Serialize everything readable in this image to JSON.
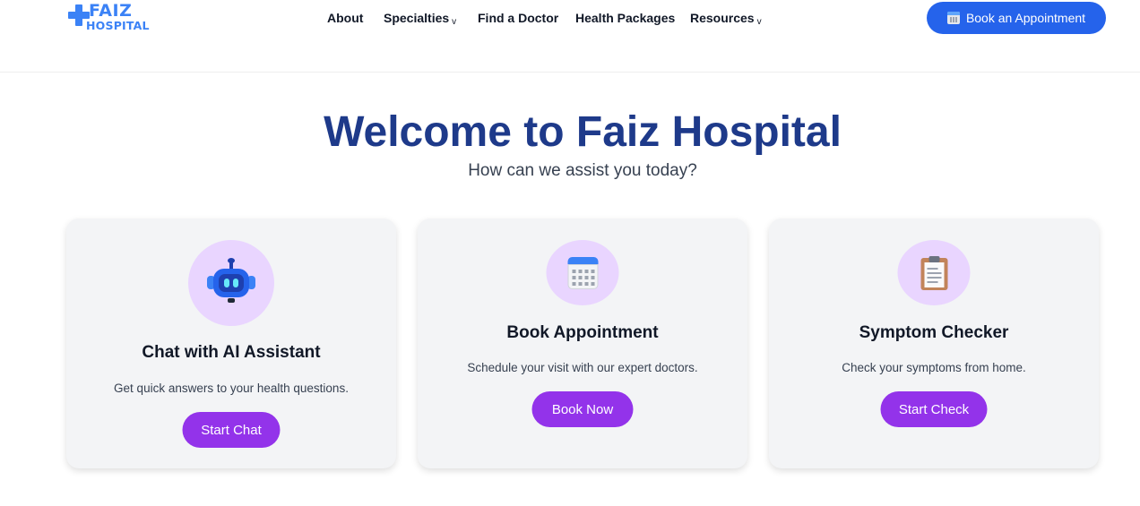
{
  "brand": {
    "name_top": "FAIZ",
    "name_bottom": "HOSPITAL",
    "color": "#3b82f6"
  },
  "nav": {
    "items": [
      {
        "label": "About",
        "has_dropdown": false
      },
      {
        "label": "Specialties",
        "has_dropdown": true
      },
      {
        "label": "Find a Doctor",
        "has_dropdown": false
      },
      {
        "label": "Health Packages",
        "has_dropdown": false
      },
      {
        "label": "Resources",
        "has_dropdown": true
      }
    ],
    "dropdown_glyph": "v",
    "cta": {
      "label": "Book an Appointment",
      "icon": "calendar-icon",
      "color": "#2563eb"
    }
  },
  "hero": {
    "title": "Welcome to Faiz Hospital",
    "subtitle": "How can we assist you today?",
    "title_color": "#1e3a8a"
  },
  "cards": [
    {
      "icon": "robot-icon",
      "title": "Chat with AI Assistant",
      "description": "Get quick answers to your health questions.",
      "button": "Start Chat"
    },
    {
      "icon": "calendar-icon",
      "title": "Book Appointment",
      "description": "Schedule your visit with our expert doctors.",
      "button": "Book Now"
    },
    {
      "icon": "clipboard-icon",
      "title": "Symptom Checker",
      "description": "Check your symptoms from home.",
      "button": "Start Check"
    }
  ],
  "colors": {
    "card_bg": "#f3f4f6",
    "icon_circle": "#e9d5ff",
    "button": "#9333ea"
  }
}
